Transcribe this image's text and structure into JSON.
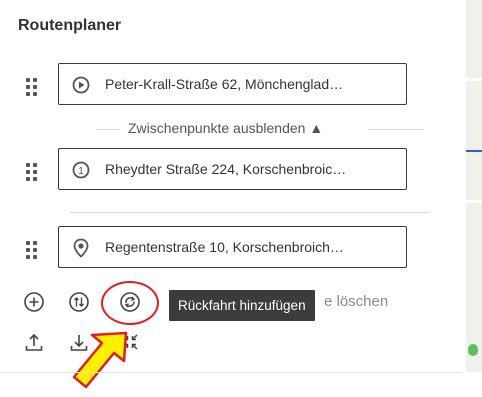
{
  "panel": {
    "title": "Routenplaner"
  },
  "route": {
    "stops": [
      {
        "icon": "start-pin-icon",
        "value": "Peter-Krall-Straße 62, Mönchenglad…"
      },
      {
        "icon": "waypoint-1-icon",
        "value": "Rheydter Straße 224, Korschenbroic…"
      },
      {
        "icon": "destination-pin-icon",
        "value": "Regentenstraße 10, Korschenbroich…"
      }
    ],
    "toggle_waypoints": "Zwischenpunkte ausblenden ▲"
  },
  "toolbar": {
    "delete_label": "e löschen",
    "tooltip": "Rückfahrt hinzufügen",
    "icons": [
      "add-stop-icon",
      "swap-route-icon",
      "return-trip-icon",
      "upload-icon",
      "download-icon",
      "collapse-icon"
    ]
  },
  "colors": {
    "highlight": "#e02020",
    "arrow_fill": "#ffef00",
    "tooltip_bg": "#3c3c3c",
    "route_line": "#3b5bd6"
  }
}
